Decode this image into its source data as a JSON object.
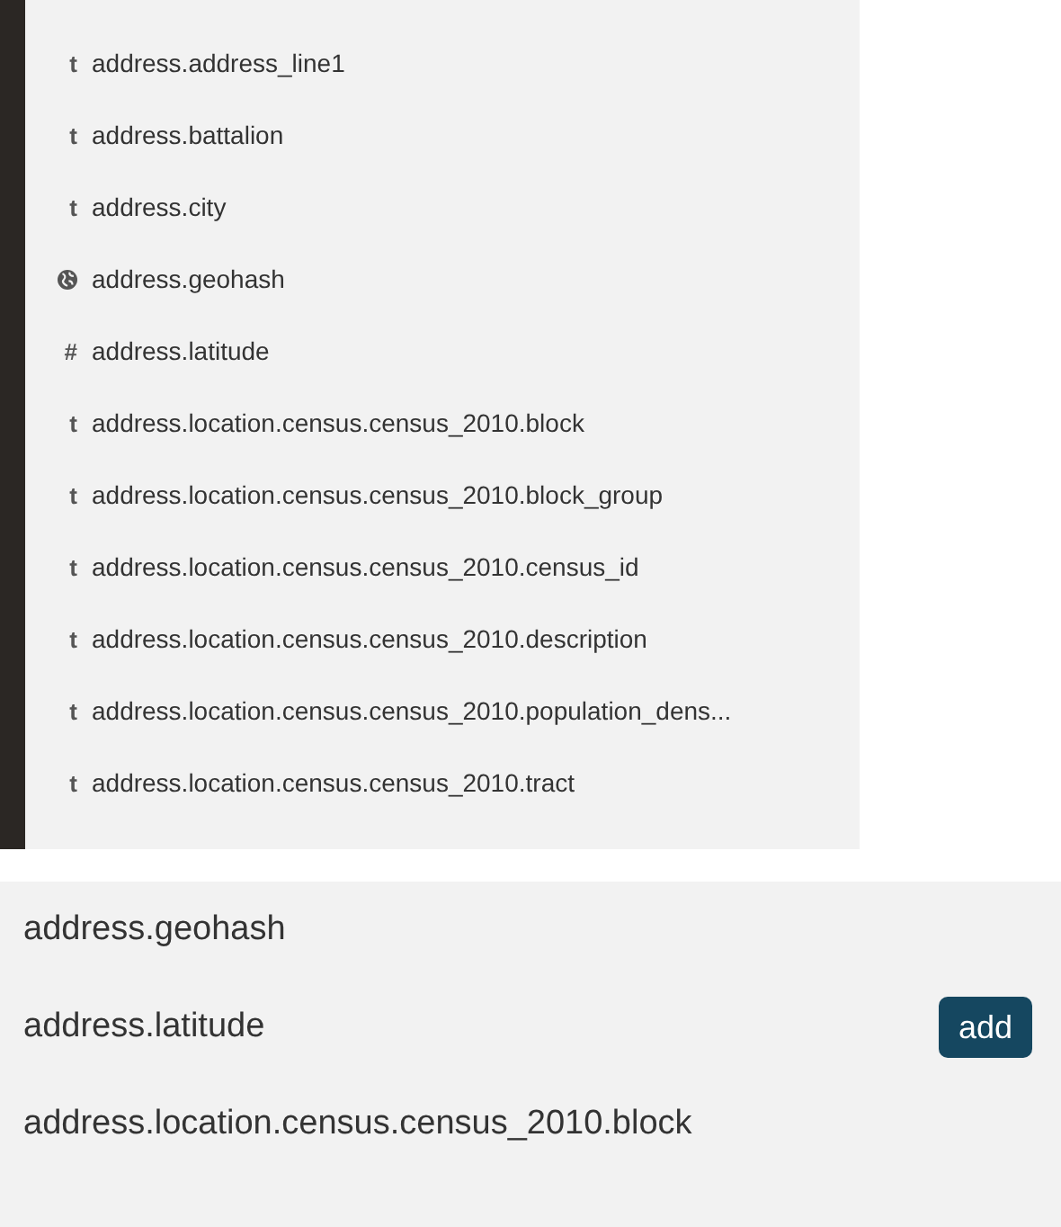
{
  "field_list": [
    {
      "kind": "string",
      "glyph": "t",
      "name": "address.address_line1"
    },
    {
      "kind": "string",
      "glyph": "t",
      "name": "address.battalion"
    },
    {
      "kind": "string",
      "glyph": "t",
      "name": "address.city"
    },
    {
      "kind": "geo",
      "name": "address.geohash"
    },
    {
      "kind": "number",
      "glyph": "#",
      "name": "address.latitude"
    },
    {
      "kind": "string",
      "glyph": "t",
      "name": "address.location.census.census_2010.block"
    },
    {
      "kind": "string",
      "glyph": "t",
      "name": "address.location.census.census_2010.block_group"
    },
    {
      "kind": "string",
      "glyph": "t",
      "name": "address.location.census.census_2010.census_id"
    },
    {
      "kind": "string",
      "glyph": "t",
      "name": "address.location.census.census_2010.description"
    },
    {
      "kind": "string",
      "glyph": "t",
      "name": "address.location.census.census_2010.population_dens..."
    },
    {
      "kind": "string",
      "glyph": "t",
      "name": "address.location.census.census_2010.tract"
    }
  ],
  "zoomed_list": [
    {
      "name": "address.geohash"
    },
    {
      "name": "address.latitude",
      "button": "add"
    },
    {
      "name": "address.location.census.census_2010.block"
    }
  ]
}
